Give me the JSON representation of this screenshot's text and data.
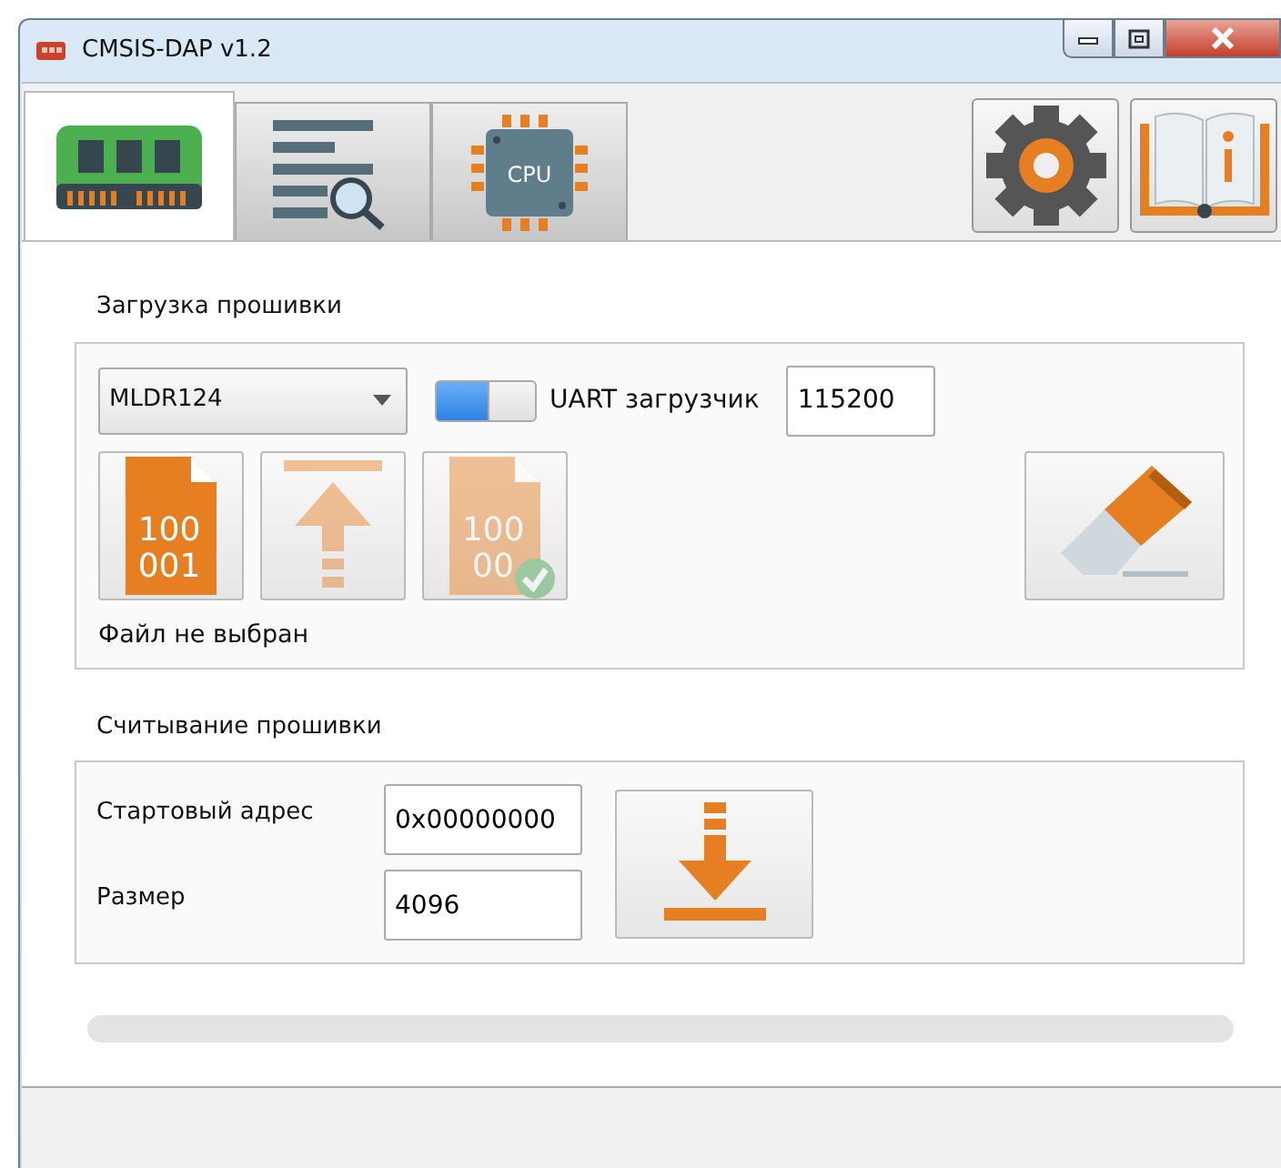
{
  "window": {
    "title": "CMSIS-DAP v1.2"
  },
  "tabs": [
    {
      "kind": "memory",
      "selected": true
    },
    {
      "kind": "log",
      "selected": false
    },
    {
      "kind": "cpu",
      "label": "CPU",
      "selected": false
    }
  ],
  "tools": [
    {
      "kind": "settings"
    },
    {
      "kind": "info"
    }
  ],
  "upload": {
    "title": "Загрузка прошивки",
    "device": "MLDR124",
    "uart_toggle": {
      "on": true
    },
    "uart_label": "UART загрузчик",
    "baud": "115200",
    "actions": [
      {
        "kind": "open",
        "lines": [
          "100",
          "001"
        ],
        "disabled": false
      },
      {
        "kind": "upload",
        "disabled": true
      },
      {
        "kind": "verify",
        "lines": [
          "100",
          "00"
        ],
        "disabled": true
      }
    ],
    "erase": {
      "disabled": false
    },
    "status": "Файл не выбран"
  },
  "read": {
    "title": "Считывание прошивки",
    "fields": [
      {
        "label": "Стартовый адрес",
        "value": "0x00000000"
      },
      {
        "label": "Размер",
        "value": "4096"
      }
    ]
  },
  "progress": {
    "level": 0
  }
}
